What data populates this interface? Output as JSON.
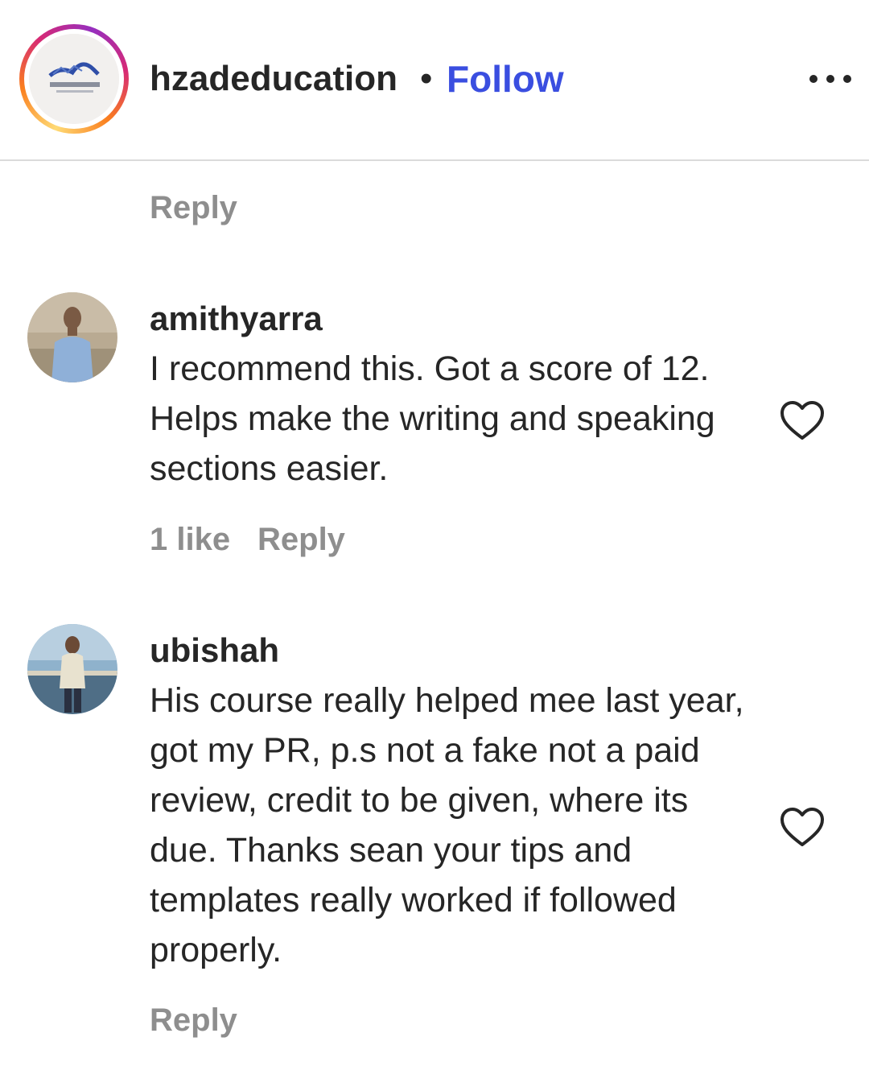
{
  "post": {
    "username": "hzadeducation",
    "separator": "•",
    "follow_label": "Follow",
    "more_icon": "more-horizontal-icon",
    "follow_color": "#3a4ee0"
  },
  "top_reply": {
    "reply_label": "Reply"
  },
  "comments": [
    {
      "username": "amithyarra",
      "text": "I recommend this. Got a score of 12. Helps make the writing and speaking sections easier.",
      "likes_label": "1 like",
      "reply_label": "Reply",
      "like_icon": "heart-outline-icon"
    },
    {
      "username": "ubishah",
      "text": "His course really helped mee last year, got my PR, p.s not a fake not a paid review, credit to be given, where its due. Thanks sean your tips and templates really worked if followed properly.",
      "reply_label": "Reply",
      "like_icon": "heart-outline-icon"
    }
  ]
}
